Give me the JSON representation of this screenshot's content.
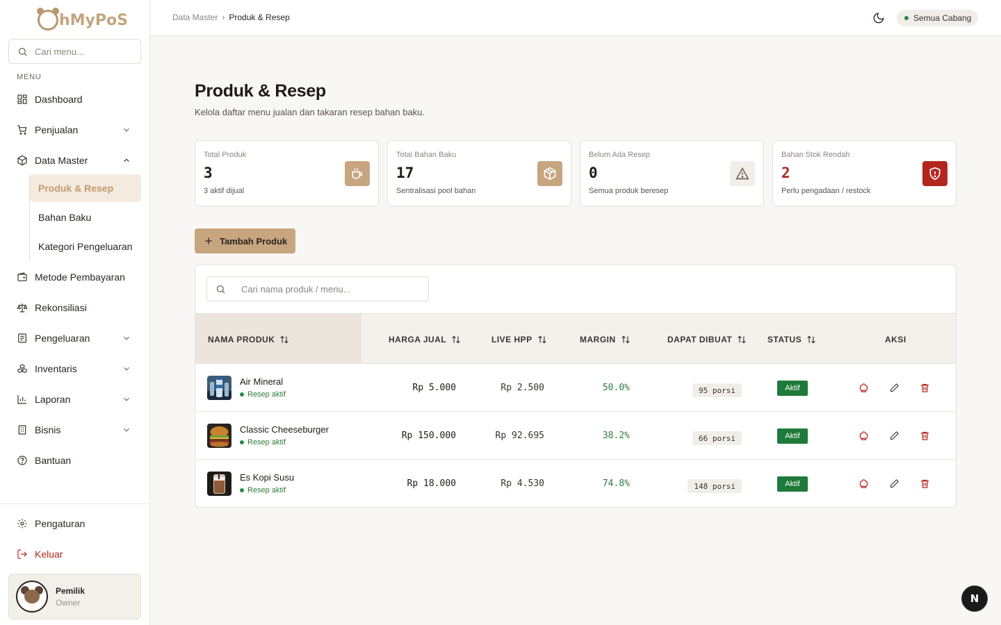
{
  "app": {
    "logo_text": "hMyPoS"
  },
  "sidebar": {
    "search_placeholder": "Cari menu...",
    "section_label": "MENU",
    "items": [
      {
        "label": "Dashboard",
        "icon": "dashboard-icon"
      },
      {
        "label": "Penjualan",
        "icon": "cart-icon"
      },
      {
        "label": "Data Master",
        "icon": "box-icon"
      },
      {
        "label": "Metode Pembayaran",
        "icon": "wallet-icon"
      },
      {
        "label": "Rekonsiliasi",
        "icon": "scale-icon"
      },
      {
        "label": "Pengeluaran",
        "icon": "receipt-icon"
      },
      {
        "label": "Inventaris",
        "icon": "boxes-icon"
      },
      {
        "label": "Laporan",
        "icon": "chart-icon"
      },
      {
        "label": "Bisnis",
        "icon": "building-icon"
      },
      {
        "label": "Bantuan",
        "icon": "help-icon"
      }
    ],
    "sub_items": [
      "Produk & Resep",
      "Bahan Baku",
      "Kategori Pengeluaran"
    ],
    "settings_label": "Pengaturan",
    "logout_label": "Keluar",
    "user": {
      "name": "Pemilik",
      "role": "Owner"
    }
  },
  "topbar": {
    "breadcrumb_parent": "Data Master",
    "breadcrumb_sep": "›",
    "breadcrumb_current": "Produk & Resep",
    "branch_label": "Semua Cabang"
  },
  "page": {
    "title": "Produk & Resep",
    "subtitle": "Kelola daftar menu jualan dan takaran resep bahan baku."
  },
  "stats": [
    {
      "label": "Total Produk",
      "value": "3",
      "desc": "3 aktif dijual",
      "icon": "coffee-icon",
      "color": "#c7a57f"
    },
    {
      "label": "Total Bahan Baku",
      "value": "17",
      "desc": "Sentralisasi pool bahan",
      "icon": "package-icon",
      "color": "#c7a57f"
    },
    {
      "label": "Belum Ada Resep",
      "value": "0",
      "desc": "Semua produk beresep",
      "icon": "warning-icon",
      "color": "#f1eee9"
    },
    {
      "label": "Bahan Stok Rendah",
      "value": "2",
      "desc": "Perlu pengadaan / restock",
      "icon": "shield-alert-icon",
      "color": "#b3261e"
    }
  ],
  "add_button_label": "Tambah Produk",
  "table": {
    "search_placeholder": "Cari nama produk / menu...",
    "columns": [
      "NAMA PRODUK",
      "HARGA JUAL",
      "LIVE HPP",
      "MARGIN",
      "DAPAT DIBUAT",
      "STATUS",
      "AKSI"
    ],
    "rows": [
      {
        "name": "Air Mineral",
        "recipe_status": "Resep aktif",
        "price": "Rp 5.000",
        "hpp": "Rp 2.500",
        "margin": "50.0%",
        "portions": "95 porsi",
        "status": "Aktif"
      },
      {
        "name": "Classic Cheeseburger",
        "recipe_status": "Resep aktif",
        "price": "Rp 150.000",
        "hpp": "Rp 92.695",
        "margin": "38.2%",
        "portions": "66 porsi",
        "status": "Aktif"
      },
      {
        "name": "Es Kopi Susu",
        "recipe_status": "Resep aktif",
        "price": "Rp 18.000",
        "hpp": "Rp 4.530",
        "margin": "74.8%",
        "portions": "148 porsi",
        "status": "Aktif"
      }
    ]
  },
  "colors": {
    "accent": "#c7a57f",
    "danger": "#b3261e",
    "success": "#1f7a3a"
  }
}
